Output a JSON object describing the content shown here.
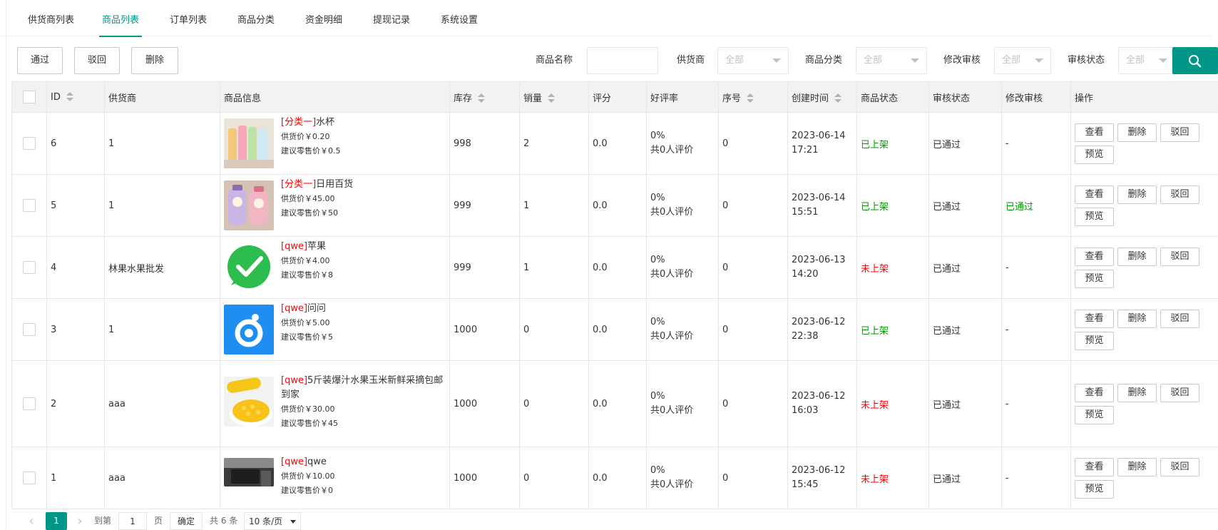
{
  "tabs": [
    {
      "label": "供货商列表"
    },
    {
      "label": "商品列表"
    },
    {
      "label": "订单列表"
    },
    {
      "label": "商品分类"
    },
    {
      "label": "资金明细"
    },
    {
      "label": "提现记录"
    },
    {
      "label": "系统设置"
    }
  ],
  "active_tab": "商品列表",
  "toolbar": {
    "approve_label": "通过",
    "reject_label": "驳回",
    "delete_label": "删除"
  },
  "filters": {
    "name_label": "商品名称",
    "name_value": "",
    "supplier_label": "供货商",
    "supplier_value": "全部",
    "category_label": "商品分类",
    "category_value": "全部",
    "edit_audit_label": "修改审核",
    "edit_audit_value": "全部",
    "audit_label": "审核状态",
    "audit_value": "全部"
  },
  "colors": {
    "accent": "#009688",
    "ok": "#009900",
    "warn": "#ff0000"
  },
  "table": {
    "headers": {
      "id": "ID",
      "supplier": "供货商",
      "goods": "商品信息",
      "stock": "库存",
      "sales": "销量",
      "score": "评分",
      "praise": "好评率",
      "order": "序号",
      "created": "创建时间",
      "goods_status": "商品状态",
      "audit_status": "审核状态",
      "edit_audit": "修改审核",
      "ops": "操作"
    },
    "rows": [
      {
        "id": "6",
        "supplier": "1",
        "cat": "[分类一]",
        "name": "水杯",
        "supply_price": "供货价￥0.20",
        "retail_price": "建议零售价￥0.5",
        "stock": "998",
        "sales": "2",
        "score": "0.0",
        "praise_rate": "0%",
        "praise_count": "共0人评价",
        "order": "0",
        "created": "2023-06-14 17:21",
        "goods_status": "已上架",
        "audit_status": "已通过",
        "edit_audit": "-",
        "thumb": "cups-image"
      },
      {
        "id": "5",
        "supplier": "1",
        "cat": "[分类一]",
        "name": "日用百货",
        "supply_price": "供货价￥45.00",
        "retail_price": "建议零售价￥50",
        "stock": "999",
        "sales": "1",
        "score": "0.0",
        "praise_rate": "0%",
        "praise_count": "共0人评价",
        "order": "0",
        "created": "2023-06-14 15:51",
        "goods_status": "已上架",
        "audit_status": "已通过",
        "edit_audit": "已通过",
        "thumb": "bottles-image"
      },
      {
        "id": "4",
        "supplier": "林果水果批发",
        "cat": "[qwe]",
        "name": "苹果",
        "supply_price": "供货价￥4.00",
        "retail_price": "建议零售价￥8",
        "stock": "999",
        "sales": "1",
        "score": "0.0",
        "praise_rate": "0%",
        "praise_count": "共0人评价",
        "order": "0",
        "created": "2023-06-13 14:20",
        "goods_status": "未上架",
        "audit_status": "已通过",
        "edit_audit": "-",
        "thumb": "check-logo-image"
      },
      {
        "id": "3",
        "supplier": "1",
        "cat": "[qwe]",
        "name": "问问",
        "supply_price": "供货价￥5.00",
        "retail_price": "建议零售价￥5",
        "stock": "1000",
        "sales": "0",
        "score": "0.0",
        "praise_rate": "0%",
        "praise_count": "共0人评价",
        "order": "0",
        "created": "2023-06-12 22:38",
        "goods_status": "已上架",
        "audit_status": "已通过",
        "edit_audit": "-",
        "thumb": "blue-logo-image"
      },
      {
        "id": "2",
        "supplier": "aaa",
        "cat": "[qwe]",
        "name": "5斤装爆汁水果玉米新鲜采摘包邮到家",
        "supply_price": "供货价￥30.00",
        "retail_price": "建议零售价￥45",
        "stock": "1000",
        "sales": "0",
        "score": "0.0",
        "praise_rate": "0%",
        "praise_count": "共0人评价",
        "order": "0",
        "created": "2023-06-12 16:03",
        "goods_status": "未上架",
        "audit_status": "已通过",
        "edit_audit": "-",
        "thumb": "corn-image"
      },
      {
        "id": "1",
        "supplier": "aaa",
        "cat": "[qwe]",
        "name": "qwe",
        "supply_price": "供货价￥10.00",
        "retail_price": "建议零售价￥0",
        "stock": "1000",
        "sales": "0",
        "score": "0.0",
        "praise_rate": "0%",
        "praise_count": "共0人评价",
        "order": "0",
        "created": "2023-06-12 15:45",
        "goods_status": "未上架",
        "audit_status": "已通过",
        "edit_audit": "-",
        "thumb": "kitchen-image"
      }
    ],
    "ops": {
      "view": "查看",
      "delete": "删除",
      "reject": "驳回",
      "preview": "预览"
    }
  },
  "pager": {
    "current": "1",
    "goto_label": "到第",
    "goto_value": "1",
    "page_unit": "页",
    "confirm": "确定",
    "total": "共 6 条",
    "page_size": "10 条/页"
  }
}
